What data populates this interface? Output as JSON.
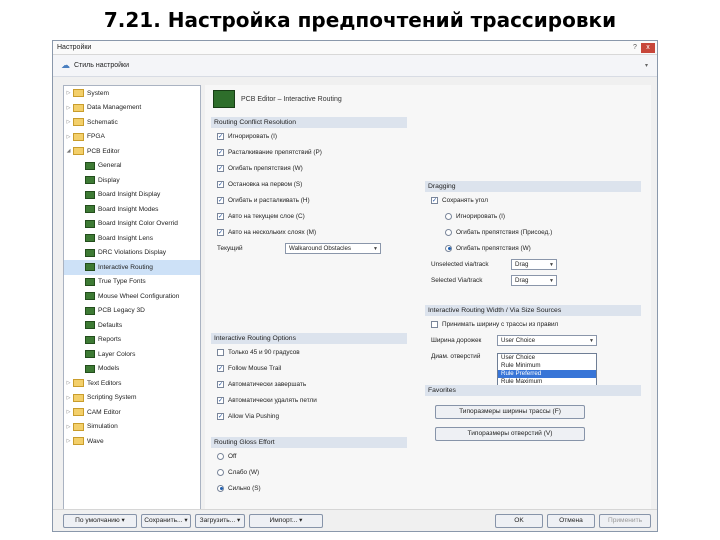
{
  "slide_title": "7.21. Настройка предпочтений трассировки",
  "window": {
    "title": "Настройки",
    "close": "x",
    "help": "?"
  },
  "header": {
    "label": "Стиль настройки",
    "dropdown": "▾"
  },
  "tree": {
    "items": [
      {
        "label": "System",
        "type": "folder",
        "level": 0
      },
      {
        "label": "Data Management",
        "type": "folder",
        "level": 0
      },
      {
        "label": "Schematic",
        "type": "folder",
        "level": 0
      },
      {
        "label": "FPGA",
        "type": "folder",
        "level": 0
      },
      {
        "label": "PCB Editor",
        "type": "folder",
        "level": 0,
        "expanded": true
      },
      {
        "label": "General",
        "type": "page",
        "level": 1
      },
      {
        "label": "Display",
        "type": "page",
        "level": 1
      },
      {
        "label": "Board Insight Display",
        "type": "page",
        "level": 1
      },
      {
        "label": "Board Insight Modes",
        "type": "page",
        "level": 1
      },
      {
        "label": "Board Insight Color Overrid",
        "type": "page",
        "level": 1
      },
      {
        "label": "Board Insight Lens",
        "type": "page",
        "level": 1
      },
      {
        "label": "DRC Violations Display",
        "type": "page",
        "level": 1
      },
      {
        "label": "Interactive Routing",
        "type": "page",
        "level": 1,
        "selected": true
      },
      {
        "label": "True Type Fonts",
        "type": "page",
        "level": 1
      },
      {
        "label": "Mouse Wheel Configuration",
        "type": "page",
        "level": 1
      },
      {
        "label": "PCB Legacy 3D",
        "type": "page",
        "level": 1
      },
      {
        "label": "Defaults",
        "type": "page",
        "level": 1
      },
      {
        "label": "Reports",
        "type": "page",
        "level": 1
      },
      {
        "label": "Layer Colors",
        "type": "page",
        "level": 1
      },
      {
        "label": "Models",
        "type": "page",
        "level": 1
      },
      {
        "label": "Text Editors",
        "type": "folder",
        "level": 0
      },
      {
        "label": "Scripting System",
        "type": "folder",
        "level": 0
      },
      {
        "label": "CAM Editor",
        "type": "folder",
        "level": 0
      },
      {
        "label": "Simulation",
        "type": "folder",
        "level": 0
      },
      {
        "label": "Wave",
        "type": "folder",
        "level": 0
      }
    ]
  },
  "page_header": "PCB Editor – Interactive Routing",
  "conflict": {
    "title": "Routing Conflict Resolution",
    "options": [
      {
        "label": "Игнорировать (I)",
        "checked": true
      },
      {
        "label": "Расталкивание препятствий (P)",
        "checked": true
      },
      {
        "label": "Огибать препятствия (W)",
        "checked": true
      },
      {
        "label": "Остановка на первом (S)",
        "checked": true
      },
      {
        "label": "Огибать и расталкивать (H)",
        "checked": true
      },
      {
        "label": "Авто на текущем слое (C)",
        "checked": true
      },
      {
        "label": "Авто на нескольких слоях (M)",
        "checked": true
      }
    ],
    "current_label": "Текущий",
    "current_value": "Walkaround Obstacles"
  },
  "routing_options": {
    "title": "Interactive Routing Options",
    "options": [
      {
        "label": "Только 45 и 90 градусов",
        "checked": false
      },
      {
        "label": "Follow Mouse Trail",
        "checked": true
      },
      {
        "label": "Автоматически завершать",
        "checked": true
      },
      {
        "label": "Автоматически удалять петли",
        "checked": true
      },
      {
        "label": "Allow Via Pushing",
        "checked": true
      }
    ]
  },
  "gloss": {
    "title": "Routing Gloss Effort",
    "options": [
      {
        "label": "Off",
        "selected": false
      },
      {
        "label": "Слабо (W)",
        "selected": false
      },
      {
        "label": "Сильно (S)",
        "selected": true
      }
    ]
  },
  "dragging": {
    "title": "Dragging",
    "preserve_label": "Сохранять угол",
    "preserve_checked": true,
    "radios": [
      {
        "label": "Игнорировать (I)",
        "selected": false
      },
      {
        "label": "Огибать препятствия (Присоед.)",
        "selected": false
      },
      {
        "label": "Огибать препятствия (W)",
        "selected": true
      }
    ],
    "unselected_label": "Unselected via/track",
    "unselected_value": "Drag",
    "selected_label": "Selected Via/track",
    "selected_value": "Drag"
  },
  "width_sources": {
    "title": "Interactive Routing Width / Via Size Sources",
    "pickup_label": "Принимать ширину с трассы из правил",
    "pickup_checked": false,
    "width_label": "Ширина дорожек",
    "width_value": "User Choice",
    "via_label": "Диам. отверстий",
    "list": [
      "User Choice",
      "Rule Minimum",
      "Rule Preferred",
      "Rule Maximum"
    ],
    "highlighted_index": 2
  },
  "favorites": {
    "title": "Favorites",
    "btn1": "Типоразмеры ширины трассы (F)",
    "btn2": "Типоразмеры отверстий (V)"
  },
  "footer": {
    "defaults": "По умолчанию",
    "save": "Сохранить...",
    "load": "Загрузить...",
    "import": "Импорт...",
    "ok": "OK",
    "cancel": "Отмена",
    "apply": "Применить"
  }
}
